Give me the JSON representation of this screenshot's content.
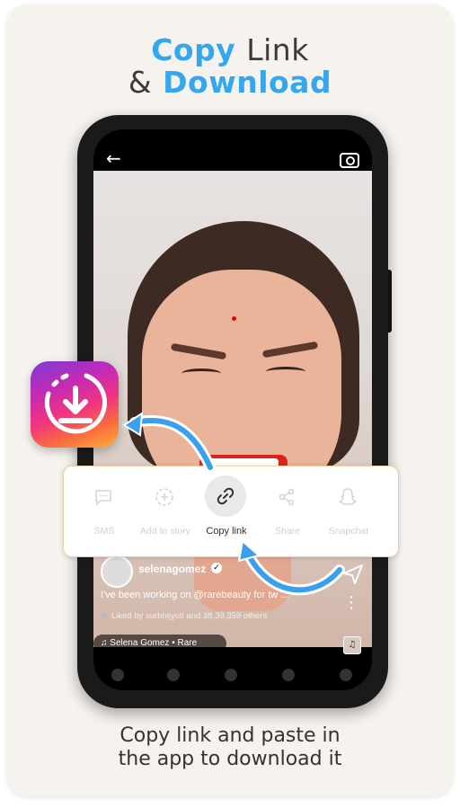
{
  "headline": {
    "line1_word1": "Copy",
    "line1_word2": "Link",
    "line2_word1": "&",
    "line2_word2": "Download"
  },
  "phone": {
    "profile": {
      "username": "selenagomez",
      "caption": "I've been working on @rarebeauty for tw ...",
      "likes_text": "Liked by surbhijyoti and 38,39,359 others"
    },
    "music": {
      "label": "Selena Gomez • Rare"
    },
    "more_glyph": "⋮"
  },
  "share_sheet": {
    "items": [
      {
        "label": "SMS",
        "icon": "sms-icon"
      },
      {
        "label": "Add to story",
        "icon": "add-story-icon"
      },
      {
        "label": "Copy link",
        "icon": "link-icon"
      },
      {
        "label": "Share",
        "icon": "share-icon"
      },
      {
        "label": "Snapchat",
        "icon": "snapchat-icon"
      }
    ]
  },
  "footer": {
    "line1": "Copy link and paste in",
    "line2": "the app to download it"
  },
  "colors": {
    "accent_blue": "#35a7ee",
    "sheet_border": "#f0cf9f"
  }
}
